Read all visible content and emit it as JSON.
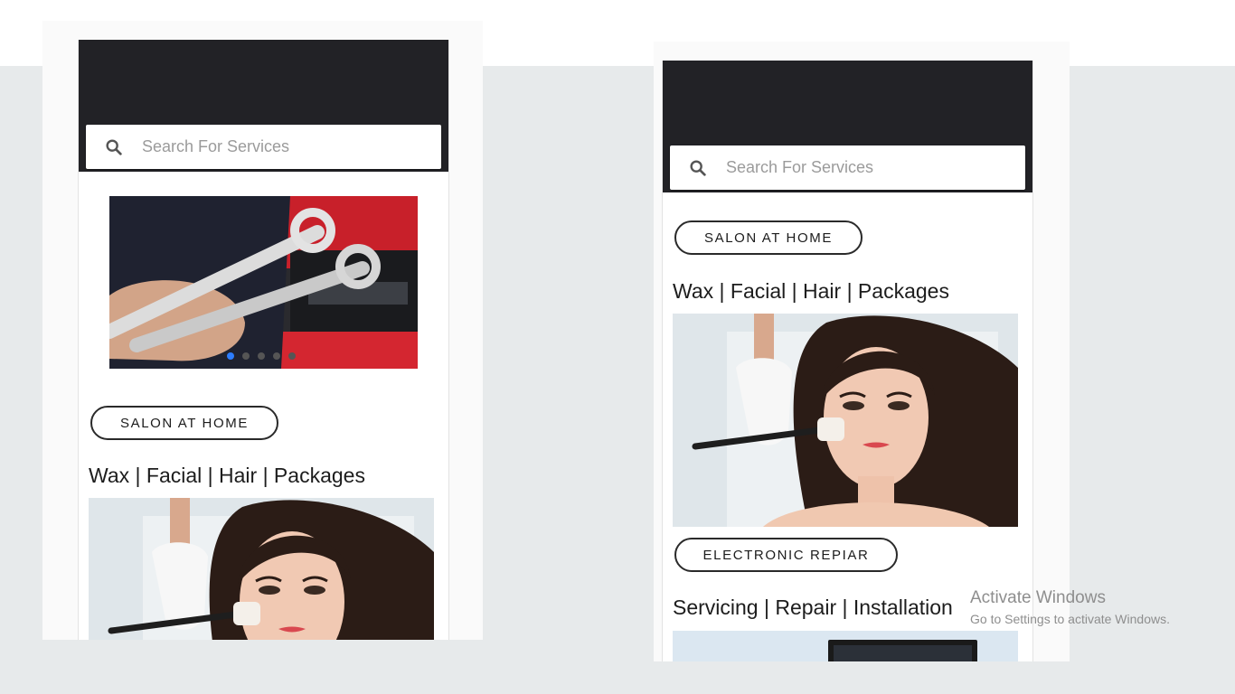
{
  "left_screen": {
    "search": {
      "placeholder": "Search For Services",
      "icon": "search-icon"
    },
    "carousel": {
      "image": "mechanic-wrenches",
      "slide_count": 5,
      "active_slide": 1
    },
    "salon": {
      "button_label": "SALON AT HOME",
      "subtitle": "Wax | Facial | Hair | Packages",
      "image": "woman-facial-treatment"
    }
  },
  "right_screen": {
    "search": {
      "placeholder": "Search For Services",
      "icon": "search-icon"
    },
    "salon": {
      "button_label": "SALON AT HOME",
      "subtitle": "Wax | Facial | Hair | Packages",
      "image": "woman-facial-treatment"
    },
    "electronic": {
      "button_label": "ELECTRONIC REPIAR",
      "subtitle": "Servicing | Repair | Installation",
      "image": "television-set"
    }
  },
  "watermark": {
    "title": "Activate Windows",
    "subtitle": "Go to Settings to activate Windows."
  },
  "colors": {
    "appbar": "#222226",
    "page_bg": "#e7eaeb",
    "active_dot": "#2d7dff"
  }
}
